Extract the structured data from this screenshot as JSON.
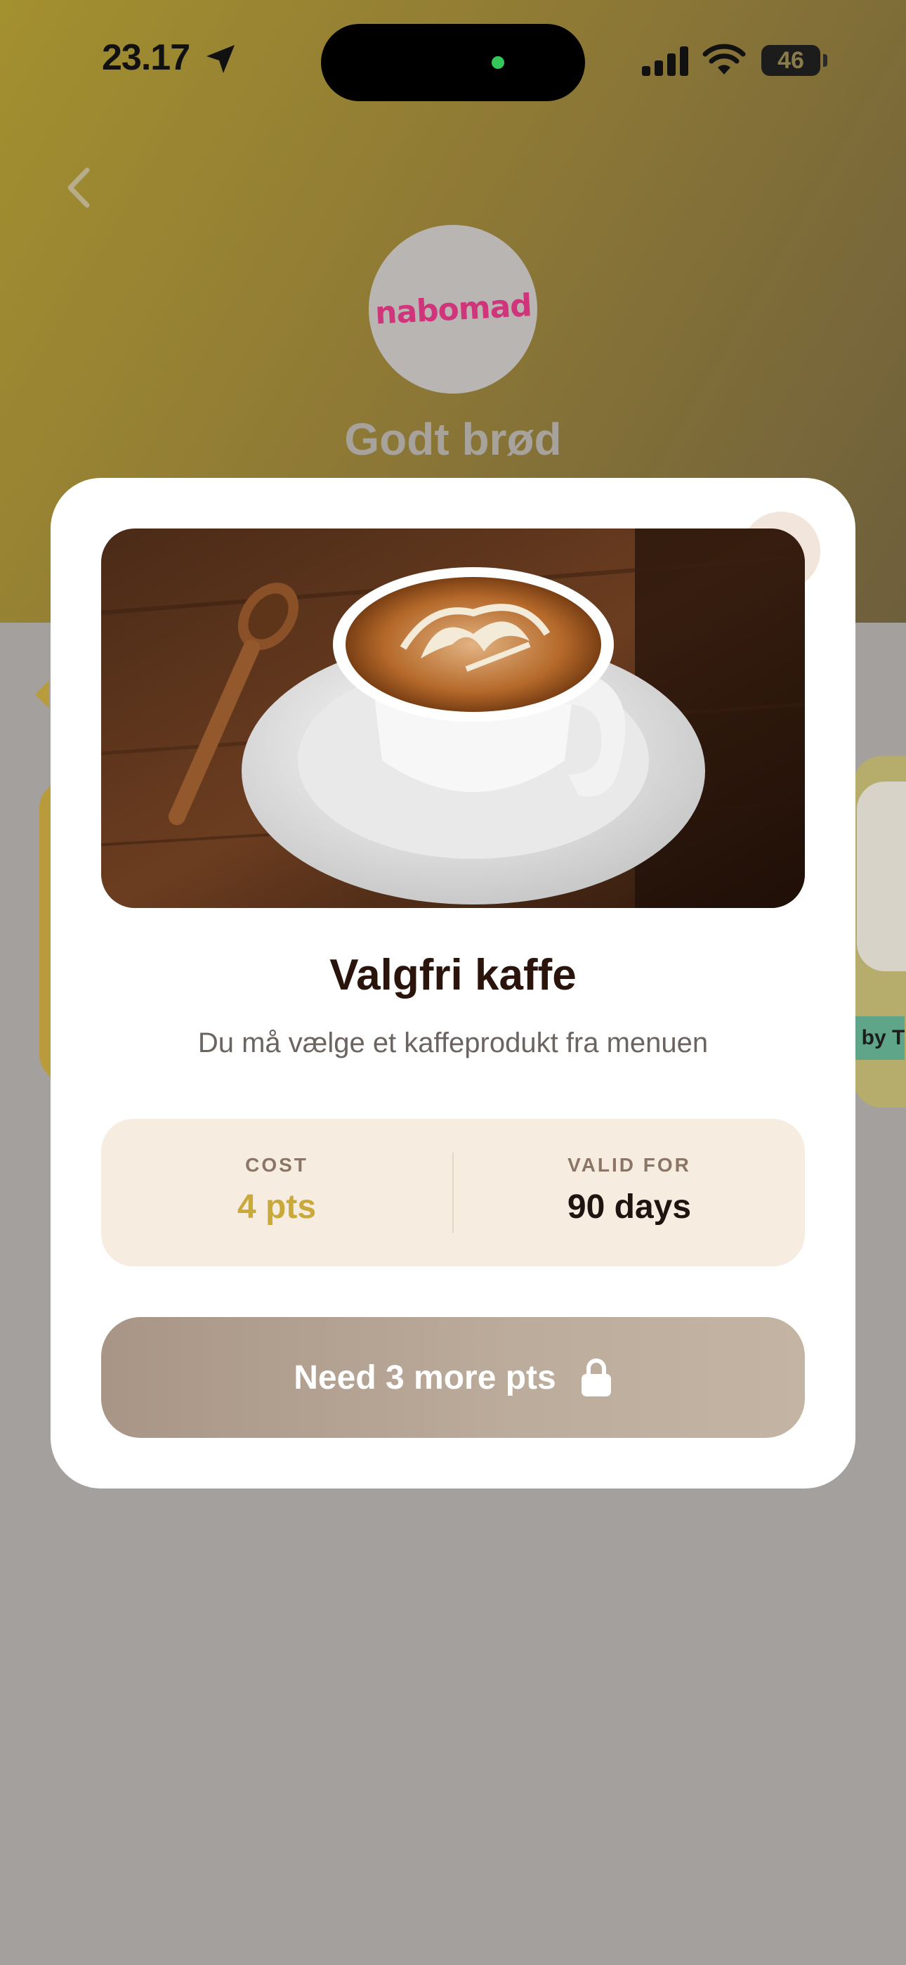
{
  "status_bar": {
    "time": "23.17",
    "battery": "46"
  },
  "header": {
    "store_logo_text": "nabomad",
    "store_name": "Godt brød"
  },
  "background": {
    "partial_tag": "p by T"
  },
  "reward": {
    "title": "Valgfri kaffe",
    "description": "Du må vælge et kaffeprodukt fra menuen",
    "cost_label": "COST",
    "cost_value": "4 pts",
    "valid_label": "VALID FOR",
    "valid_value": "90 days",
    "button_label": "Need 3 more pts"
  },
  "colors": {
    "accent": "#c9a93a",
    "title": "#2a140c",
    "button": "#b6a494"
  },
  "icons": {
    "back": "chevron-left-icon",
    "location": "location-arrow-icon",
    "signal": "cellular-signal-icon",
    "wifi": "wifi-icon",
    "lock": "lock-icon"
  }
}
